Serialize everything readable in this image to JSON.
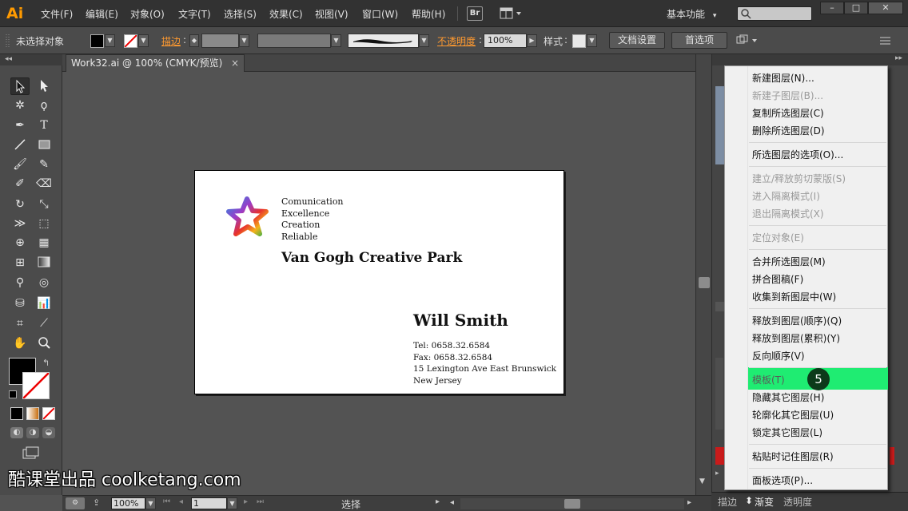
{
  "app": {
    "logo": "Ai"
  },
  "menubar": {
    "items": [
      "文件(F)",
      "编辑(E)",
      "对象(O)",
      "文字(T)",
      "选择(S)",
      "效果(C)",
      "视图(V)",
      "窗口(W)",
      "帮助(H)"
    ],
    "bridge_label": "Br",
    "workspace": "基本功能",
    "window_controls": [
      "–",
      "□",
      "✕"
    ]
  },
  "controlbar": {
    "selection_label": "未选择对象",
    "stroke_link": "描边",
    "opacity_link": "不透明度",
    "opacity_value": "100%",
    "style_label": "样式",
    "doc_settings_button": "文档设置",
    "preferences_button": "首选项"
  },
  "document": {
    "tab_title": "Work32.ai @ 100% (CMYK/预览)",
    "close_glyph": "×"
  },
  "card": {
    "tagline": [
      "Comunication",
      "Excellence",
      "Creation",
      "Reliable"
    ],
    "company": "Van Gogh Creative Park",
    "name": "Will Smith",
    "contact": [
      "Tel: 0658.32.6584",
      "Fax: 0658.32.6584",
      "15 Lexington Ave East Brunswick",
      "New Jersey"
    ]
  },
  "statusbar": {
    "zoom": "100%",
    "artboard": "1",
    "tool": "选择"
  },
  "context_menu": {
    "items": [
      {
        "label": "新建图层(N)...",
        "disabled": false
      },
      {
        "label": "新建子图层(B)...",
        "disabled": true
      },
      {
        "label": "复制所选图层(C)",
        "disabled": false
      },
      {
        "label": "删除所选图层(D)",
        "disabled": false
      },
      {
        "label": "所选图层的选项(O)...",
        "disabled": false
      },
      {
        "label": "建立/释放剪切蒙版(S)",
        "disabled": true
      },
      {
        "label": "进入隔离模式(I)",
        "disabled": true
      },
      {
        "label": "退出隔离模式(X)",
        "disabled": true
      },
      {
        "label": "定位对象(E)",
        "disabled": true
      },
      {
        "label": "合并所选图层(M)",
        "disabled": false
      },
      {
        "label": "拼合图稿(F)",
        "disabled": false
      },
      {
        "label": "收集到新图层中(W)",
        "disabled": false
      },
      {
        "label": "释放到图层(顺序)(Q)",
        "disabled": false
      },
      {
        "label": "释放到图层(累积)(Y)",
        "disabled": false
      },
      {
        "label": "反向顺序(V)",
        "disabled": false
      },
      {
        "label": "模板(T)",
        "disabled": false,
        "highlighted": true
      },
      {
        "label": "隐藏其它图层(H)",
        "disabled": false
      },
      {
        "label": "轮廓化其它图层(U)",
        "disabled": false
      },
      {
        "label": "锁定其它图层(L)",
        "disabled": false
      },
      {
        "label": "粘贴时记住图层(R)",
        "disabled": false
      },
      {
        "label": "面板选项(P)...",
        "disabled": false
      }
    ],
    "highlight_color": "#1fec72"
  },
  "step_badge": "5",
  "bottom_panel_tabs": [
    "描边",
    "渐变",
    "透明度"
  ],
  "watermark": "酷课堂出品 coolketang.com",
  "colors": {
    "accent": "#ff9a00",
    "highlight": "#1fec72"
  }
}
